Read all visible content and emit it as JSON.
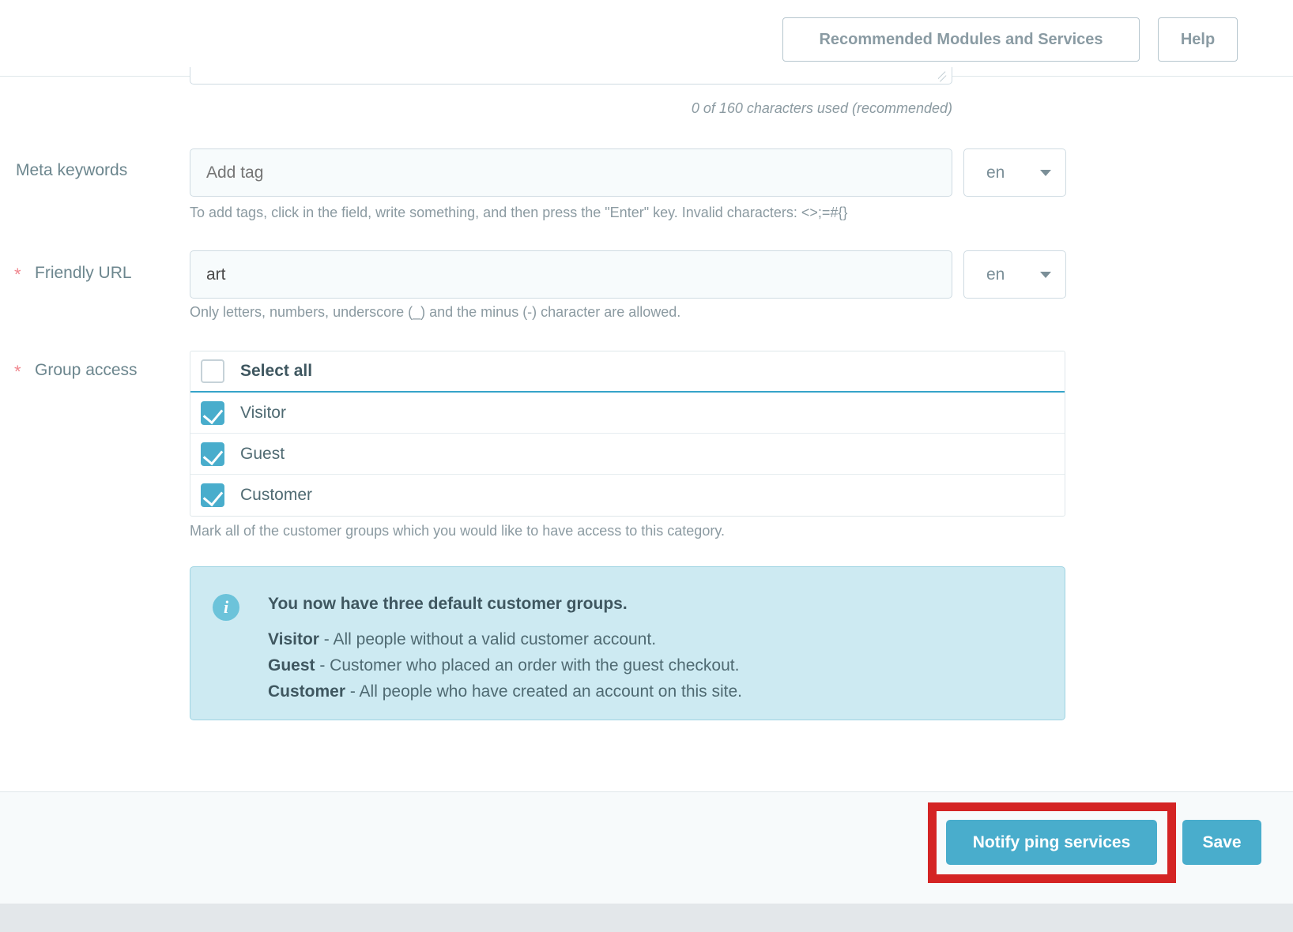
{
  "toolbar": {
    "recommended_label": "Recommended Modules and Services",
    "help_label": "Help"
  },
  "form": {
    "meta_description_counter": "0 of 160 characters used (recommended)",
    "meta_keywords": {
      "label": "Meta keywords",
      "placeholder": "Add tag",
      "value": "",
      "lang": "en",
      "hint": "To add tags, click in the field, write something, and then press the \"Enter\" key. Invalid characters: <>;=#{}"
    },
    "friendly_url": {
      "label": "Friendly URL",
      "required_marker": "*",
      "value": "art",
      "lang": "en",
      "hint": "Only letters, numbers, underscore (_) and the minus (-) character are allowed."
    },
    "group_access": {
      "label": "Group access",
      "required_marker": "*",
      "select_all_label": "Select all",
      "select_all_checked": false,
      "rows": [
        {
          "label": "Visitor",
          "checked": true
        },
        {
          "label": "Guest",
          "checked": true
        },
        {
          "label": "Customer",
          "checked": true
        }
      ],
      "hint": "Mark all of the customer groups which you would like to have access to this category."
    },
    "info_panel": {
      "icon": "info-icon",
      "title": "You now have three default customer groups.",
      "lines": [
        {
          "term": "Visitor",
          "desc": " - All people without a valid customer account."
        },
        {
          "term": "Guest",
          "desc": " - Customer who placed an order with the guest checkout."
        },
        {
          "term": "Customer",
          "desc": " - All people who have created an account on this site."
        }
      ]
    }
  },
  "footer": {
    "notify_label": "Notify ping services",
    "save_label": "Save"
  },
  "colors": {
    "accent": "#49adcc",
    "info_bg": "#cdeaf2",
    "highlight": "#d42424",
    "required_star": "#f0868e",
    "label_text": "#6c868e"
  }
}
